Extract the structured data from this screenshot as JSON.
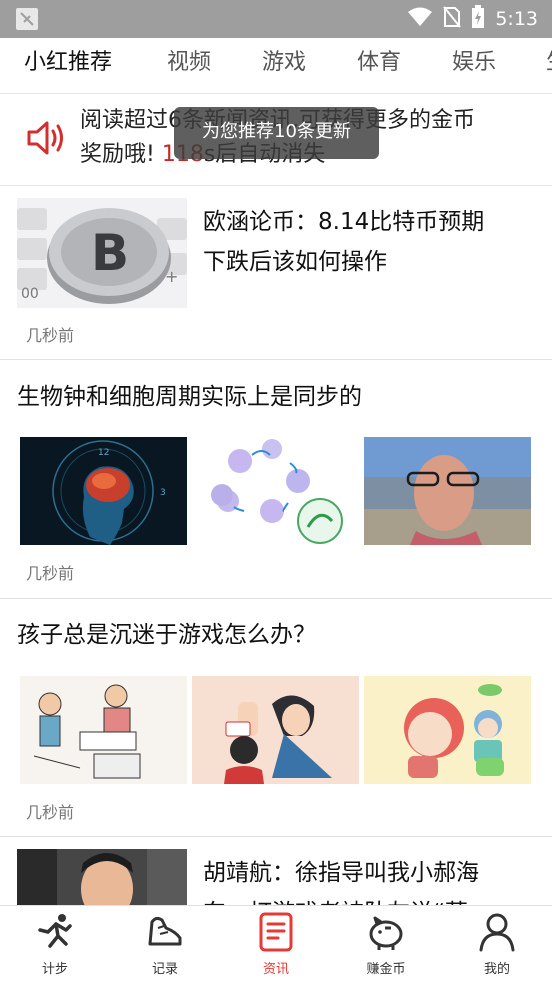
{
  "status_bar": {
    "time": "5:13"
  },
  "tabs": [
    {
      "label": "小红推荐"
    },
    {
      "label": "视频"
    },
    {
      "label": "游戏"
    },
    {
      "label": "体育"
    },
    {
      "label": "娱乐"
    },
    {
      "label": "生"
    }
  ],
  "notice": {
    "text_part1": "阅读超过6条新闻资讯,可获得更多的金币",
    "text_part2_prefix": "奖励哦! ",
    "countdown": "118",
    "text_part2_suffix": "s后自动消失"
  },
  "toast": {
    "text": "为您推荐10条更新"
  },
  "articles": [
    {
      "title_line1": "欧涵论币：8.14比特币预期",
      "title_line2": "下跌后该如何操作",
      "time": "几秒前"
    },
    {
      "title": "生物钟和细胞周期实际上是同步的",
      "time": "几秒前"
    },
    {
      "title": "孩子总是沉迷于游戏怎么办？",
      "time": "几秒前"
    },
    {
      "title_line1": "胡靖航：徐指导叫我小郝海",
      "title_line2": "东，打游戏老被队友说“菠"
    }
  ],
  "bottom_nav": [
    {
      "label": "计步",
      "icon": "running-icon"
    },
    {
      "label": "记录",
      "icon": "shoe-icon"
    },
    {
      "label": "资讯",
      "icon": "news-icon",
      "active": true
    },
    {
      "label": "赚金币",
      "icon": "piggy-bank-icon"
    },
    {
      "label": "我的",
      "icon": "person-icon"
    }
  ],
  "colors": {
    "accent": "#e53935",
    "countdown": "#c62828",
    "status_bar": "#9e9e9e"
  }
}
